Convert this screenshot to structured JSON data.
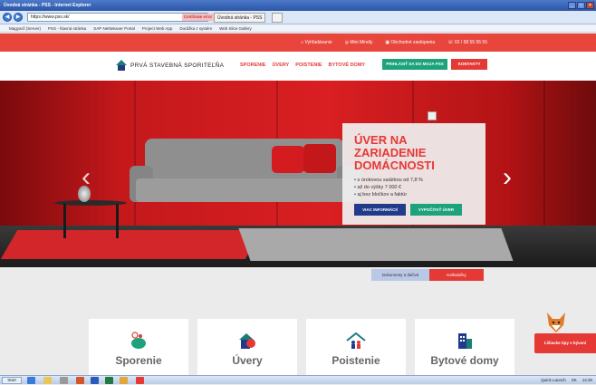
{
  "browser": {
    "title": "Úvodná stránka - PSS - Internet Explorer",
    "address": "https://www.pss.sk/",
    "cert_error": "Certificate error",
    "tabs": [
      "Úvodná stránka - PSS"
    ],
    "favorites": [
      "Magyarő (Server)",
      "PSS - hlavná stránka",
      "SAP NetWeaver Portal",
      "Project Web App",
      "Dorážka z systém",
      "Web Slice Gallery"
    ]
  },
  "topbar": {
    "items": [
      "Vyhľadávanie",
      "Mini Mindly",
      "Obchodné zastúpenia",
      "02 / 58 55 55 55"
    ]
  },
  "header": {
    "logo_text": "PRVÁ STAVEBNÁ SPORITEĽŇA",
    "nav": [
      "SPORENIE",
      "ÚVERY",
      "POISTENIE",
      "BYTOVÉ DOMY"
    ],
    "login_label": "PRIHLÁSIŤ SA DO MOJA PSS",
    "contact_label": "KONTAKTY"
  },
  "hero": {
    "title": "ÚVER NA ZARIADENIE DOMÁCNOSTI",
    "bullets": [
      "s úrokovou sadzbou od 7,8 %",
      "až do výšky 7 000 €",
      "aj bez bločkov a faktúr"
    ],
    "info_button": "VIAC INFORMÁCIÍ",
    "calc_button": "VYPOČÍTAŤ ÚVER"
  },
  "tabs": {
    "documents": "Dokumenty a tlačivá",
    "calculators": "Kalkulačky"
  },
  "cards": [
    "Sporenie",
    "Úvery",
    "Poistenie",
    "Bytové domy"
  ],
  "help": {
    "label": "Ľišiacke tipy v bývaní"
  },
  "taskbar": {
    "start": "Start",
    "quick_launch": "Quick Launch",
    "lang": "SK",
    "time": "14:30"
  },
  "colors": {
    "brand_red": "#e53935",
    "brand_green": "#1da37c",
    "brand_blue": "#1f3b8a"
  }
}
